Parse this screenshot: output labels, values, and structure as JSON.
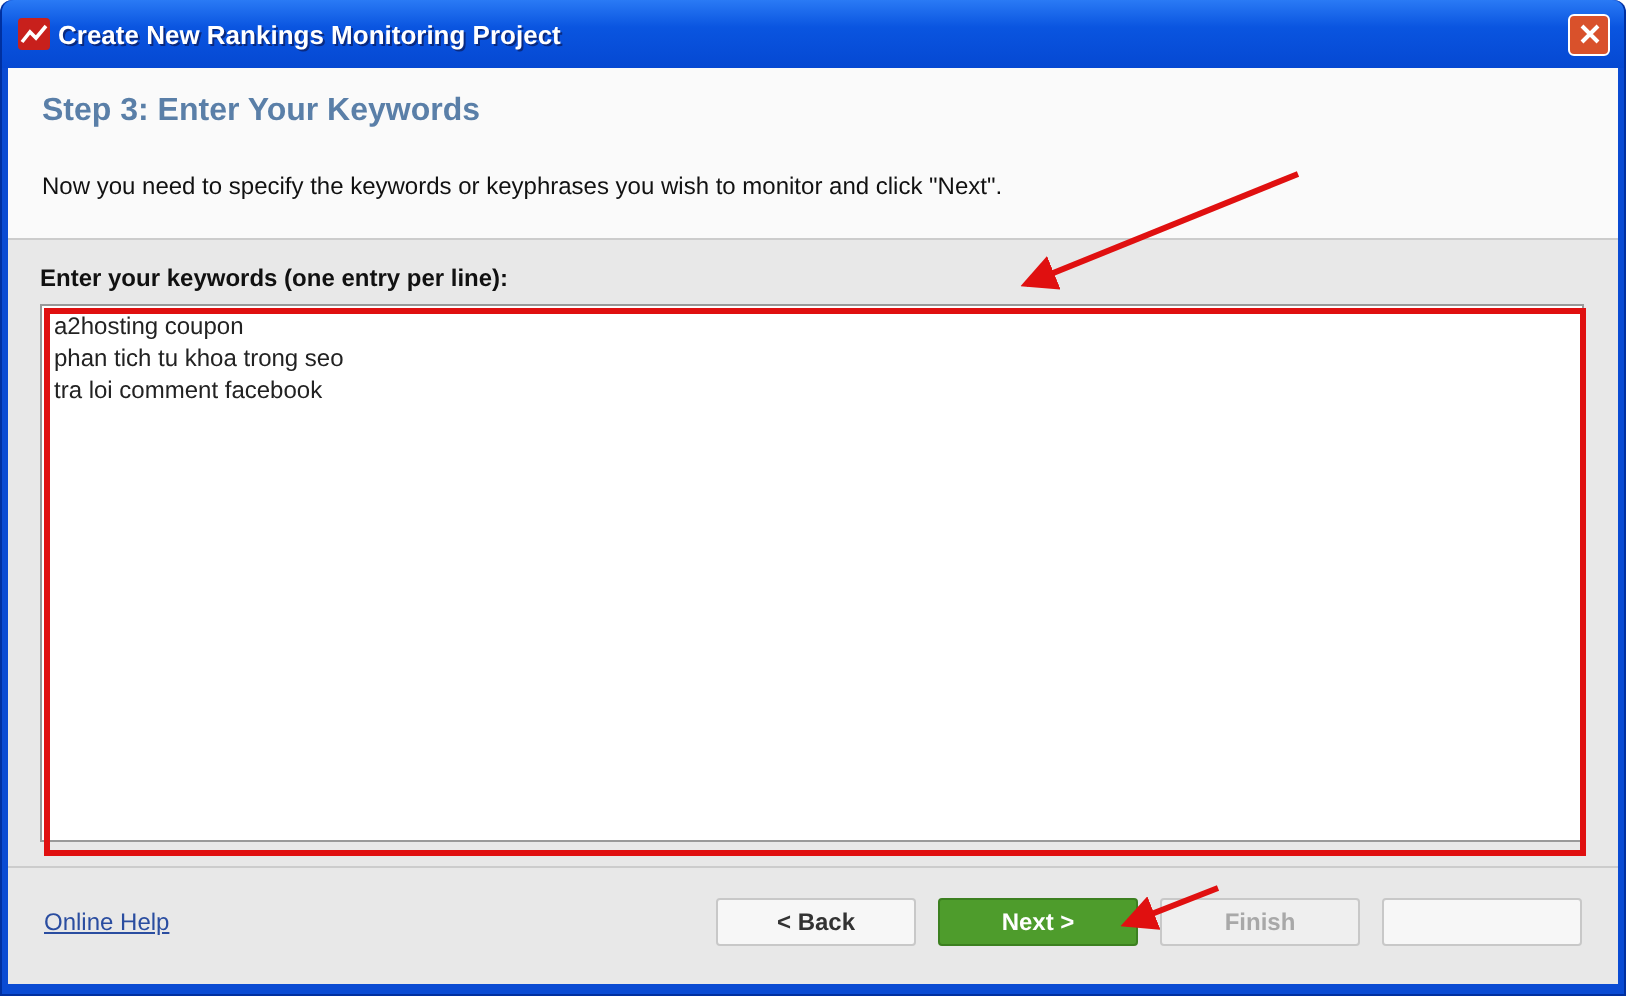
{
  "window": {
    "title": "Create New Rankings Monitoring Project"
  },
  "header": {
    "step": "Step 3: Enter Your Keywords",
    "description": "Now you need to specify the keywords or keyphrases you wish to monitor and click \"Next\"."
  },
  "keywords": {
    "label": "Enter your keywords (one entry per line):",
    "value": "a2hosting coupon\nphan tich tu khoa trong seo\ntra loi comment facebook"
  },
  "footer": {
    "help_link": "Online Help",
    "buttons": [
      {
        "label": "< Back",
        "kind": "default",
        "disabled": false
      },
      {
        "label": "Next >",
        "kind": "primary",
        "disabled": false
      },
      {
        "label": "Finish",
        "kind": "default",
        "disabled": true
      },
      {
        "kind": "default"
      }
    ]
  }
}
